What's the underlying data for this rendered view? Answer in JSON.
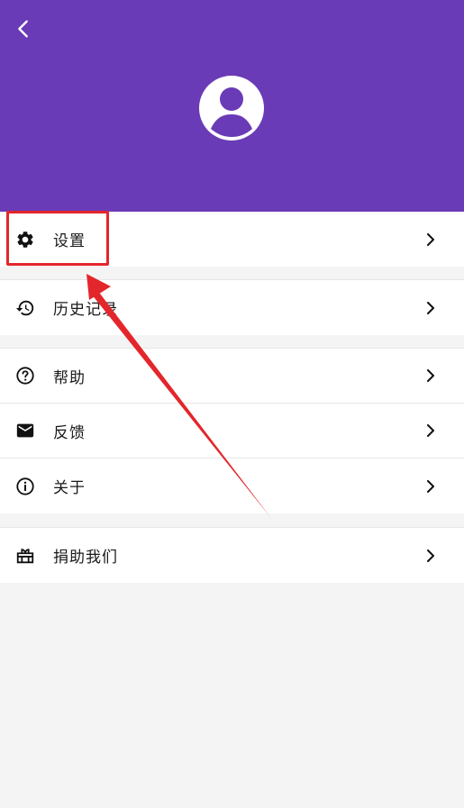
{
  "header": {
    "background_color": "#6a3bb6",
    "back_icon": "chevron-left-icon",
    "avatar_icon": "account-circle-icon"
  },
  "menu": {
    "groups": [
      {
        "items": [
          {
            "label": "设置",
            "icon": "gear-icon"
          }
        ]
      },
      {
        "items": [
          {
            "label": "历史记录",
            "icon": "history-icon"
          }
        ]
      },
      {
        "items": [
          {
            "label": "帮助",
            "icon": "help-circle-icon"
          },
          {
            "label": "反馈",
            "icon": "mail-icon"
          },
          {
            "label": "关于",
            "icon": "info-icon"
          }
        ]
      },
      {
        "items": [
          {
            "label": "捐助我们",
            "icon": "gift-icon"
          }
        ]
      }
    ]
  },
  "annotation": {
    "highlight_color": "#e3262b",
    "highlighted_item": "设置"
  }
}
